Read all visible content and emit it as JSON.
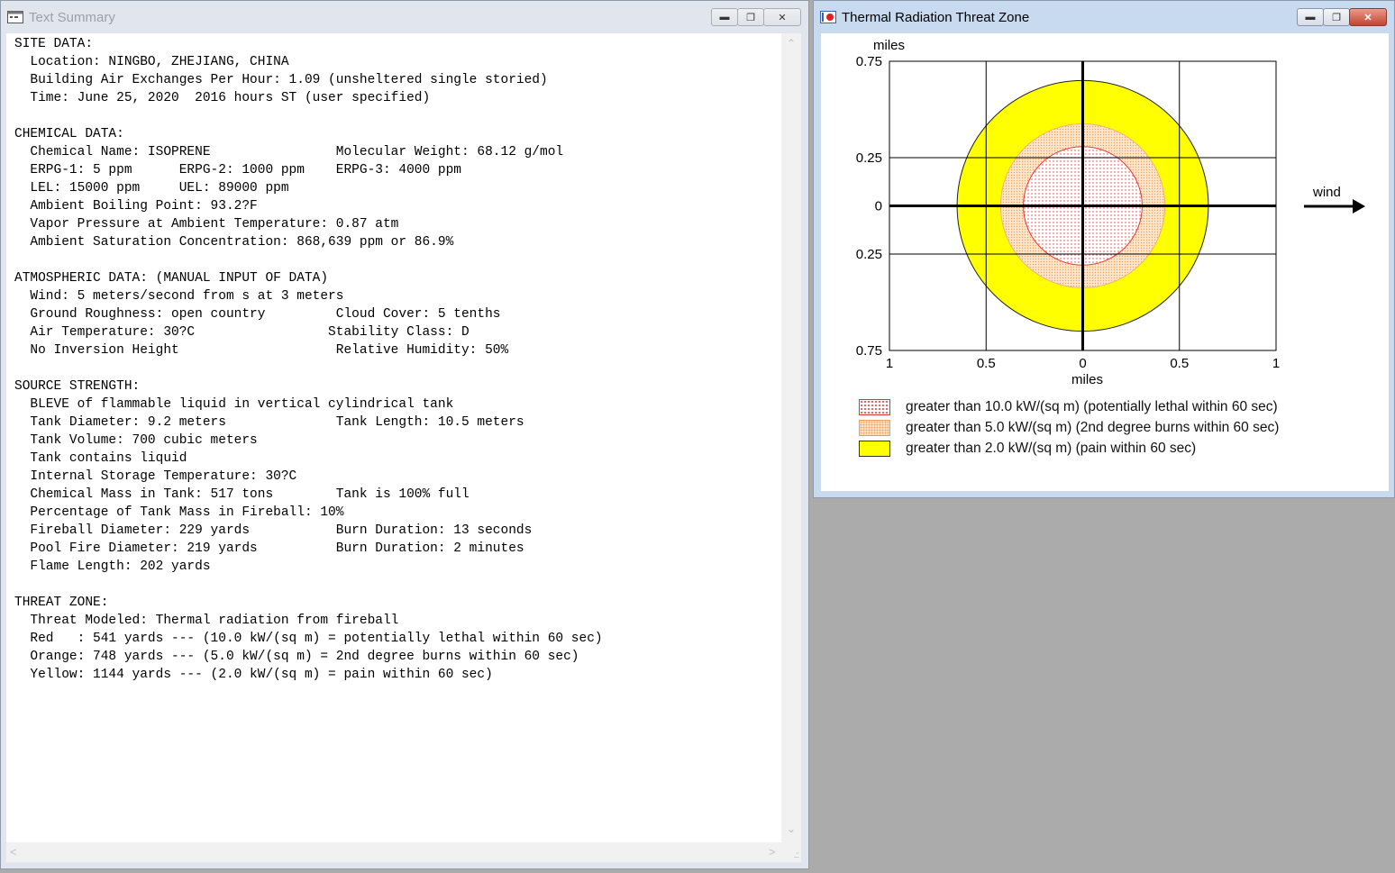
{
  "text_window": {
    "title": "Text Summary",
    "summary_lines": [
      "SITE DATA:",
      "  Location: NINGBO, ZHEJIANG, CHINA",
      "  Building Air Exchanges Per Hour: 1.09 (unsheltered single storied)",
      "  Time: June 25, 2020  2016 hours ST (user specified)",
      "",
      "CHEMICAL DATA:",
      "  Chemical Name: ISOPRENE                Molecular Weight: 68.12 g/mol",
      "  ERPG-1: 5 ppm      ERPG-2: 1000 ppm    ERPG-3: 4000 ppm",
      "  LEL: 15000 ppm     UEL: 89000 ppm",
      "  Ambient Boiling Point: 93.2?F",
      "  Vapor Pressure at Ambient Temperature: 0.87 atm",
      "  Ambient Saturation Concentration: 868,639 ppm or 86.9%",
      "",
      "ATMOSPHERIC DATA: (MANUAL INPUT OF DATA)",
      "  Wind: 5 meters/second from s at 3 meters",
      "  Ground Roughness: open country         Cloud Cover: 5 tenths",
      "  Air Temperature: 30?C                 Stability Class: D",
      "  No Inversion Height                    Relative Humidity: 50%",
      "",
      "SOURCE STRENGTH:",
      "  BLEVE of flammable liquid in vertical cylindrical tank",
      "  Tank Diameter: 9.2 meters              Tank Length: 10.5 meters",
      "  Tank Volume: 700 cubic meters",
      "  Tank contains liquid",
      "  Internal Storage Temperature: 30?C",
      "  Chemical Mass in Tank: 517 tons        Tank is 100% full",
      "  Percentage of Tank Mass in Fireball: 10%",
      "  Fireball Diameter: 229 yards           Burn Duration: 13 seconds",
      "  Pool Fire Diameter: 219 yards          Burn Duration: 2 minutes",
      "  Flame Length: 202 yards",
      "",
      "THREAT ZONE:",
      "  Threat Modeled: Thermal radiation from fireball",
      "  Red   : 541 yards --- (10.0 kW/(sq m) = potentially lethal within 60 sec)",
      "  Orange: 748 yards --- (5.0 kW/(sq m) = 2nd degree burns within 60 sec)",
      "  Yellow: 1144 yards --- (2.0 kW/(sq m) = pain within 60 sec)"
    ]
  },
  "threat_window": {
    "title": "Thermal Radiation Threat Zone",
    "y_unit": "miles",
    "x_unit": "miles",
    "wind_label": "wind",
    "legend": [
      {
        "label": "greater than 10.0 kW/(sq m) (potentially lethal within 60 sec)",
        "color": "#e53935"
      },
      {
        "label": "greater than 5.0 kW/(sq m) (2nd degree burns within 60 sec)",
        "color": "#f4a460"
      },
      {
        "label": "greater than 2.0 kW/(sq m) (pain within 60 sec)",
        "color": "#ffff00"
      }
    ]
  },
  "chart_data": {
    "type": "area",
    "title": "Thermal Radiation Threat Zone",
    "xlabel": "miles",
    "ylabel": "miles",
    "x_tick_labels": [
      "1",
      "0.5",
      "0",
      "0.5",
      "1"
    ],
    "x_tick_values": [
      -1,
      -0.5,
      0,
      0.5,
      1
    ],
    "y_tick_labels": [
      "0.75",
      "0.25",
      "0",
      "0.25",
      "0.75"
    ],
    "y_tick_values": [
      0.75,
      0.25,
      0,
      -0.25,
      -0.75
    ],
    "xlim": [
      -1,
      1
    ],
    "ylim": [
      -0.75,
      0.75
    ],
    "grid": true,
    "legend_position": "bottom",
    "series": [
      {
        "name": "greater than 2.0 kW/(sq m) (pain within 60 sec)",
        "radius_yards": 1144,
        "color": "#ffff00"
      },
      {
        "name": "greater than 5.0 kW/(sq m) (2nd degree burns within 60 sec)",
        "radius_yards": 748,
        "color": "#f4a460"
      },
      {
        "name": "greater than 10.0 kW/(sq m) (potentially lethal within 60 sec)",
        "radius_yards": 541,
        "color": "#e53935"
      }
    ]
  }
}
